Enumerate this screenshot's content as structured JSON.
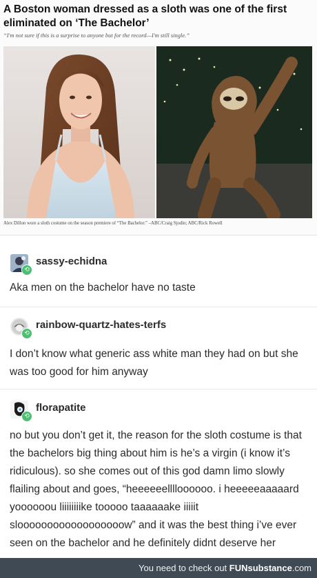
{
  "article": {
    "headline": "A Boston woman dressed as a sloth was one of the first eliminated on ‘The Bachelor’",
    "subquote": "“I'm not sure if this is a surprise to anyone but for the record—I'm still single.”",
    "caption": "Alex Dillon wore a sloth costume on the season premiere of “The Bachelor.” –ABC/Craig Sjodin; ABC/Rick Rowell"
  },
  "posts": [
    {
      "username": "sassy-echidna",
      "text": "Aka men on the bachelor have no taste"
    },
    {
      "username": "rainbow-quartz-hates-terfs",
      "text": "I don’t know what generic ass white man they had on but she was too good for him anyway"
    },
    {
      "username": "florapatite",
      "text": "no but you don’t get it, the reason for the sloth costume is that the bachelors big thing about him is he’s a virgin (i know it’s ridiculous). so she comes out of this god damn limo slowly flailing about and goes, “heeeeeelllloooooo. i heeeeeaaaaard yoooooou liiiiiiiike tooooo taaaaaake iiiiit sloooooooooooooooooow” and it was the best thing i’ve ever seen on the bachelor and he definitely didnt deserve her"
    }
  ],
  "footer": {
    "lead": "You need to check out",
    "brand": "FUNsubstance",
    "domain": ".com"
  },
  "icons": {
    "reblog": "reblog-icon"
  },
  "colors": {
    "reblog_badge": "#4fbd72",
    "footer_bg": "#3f4a55"
  }
}
